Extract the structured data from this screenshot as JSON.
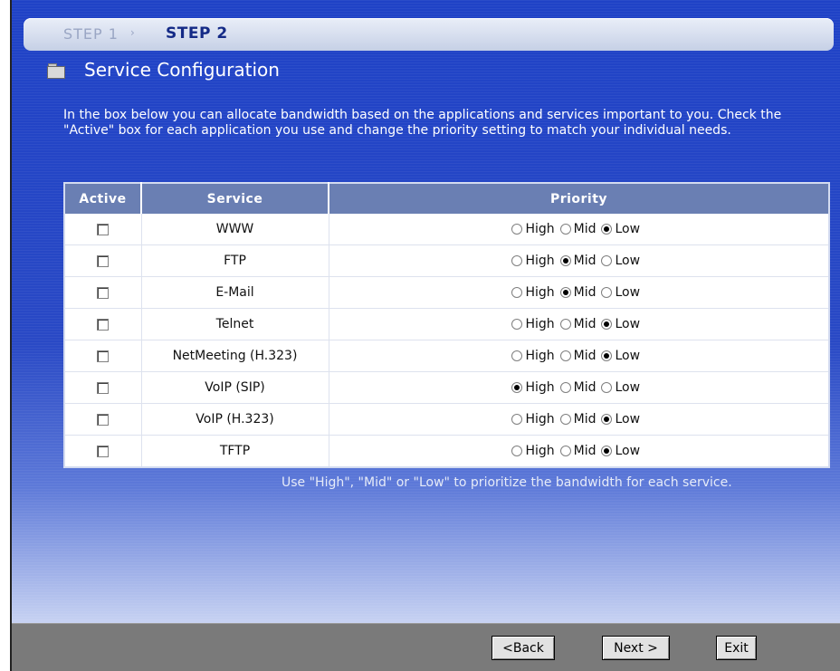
{
  "steps": {
    "step1": "STEP 1",
    "separator": "›",
    "step2": "STEP 2"
  },
  "page_title": "Service Configuration",
  "intro": "In the box below you can allocate bandwidth based on the applications and services important to you. Check the \"Active\" box for each application you use and change the priority setting to match your individual needs.",
  "table": {
    "headers": {
      "active": "Active",
      "service": "Service",
      "priority": "Priority"
    },
    "priority_options": [
      "High",
      "Mid",
      "Low"
    ],
    "rows": [
      {
        "active": false,
        "service": "WWW",
        "priority": "Low"
      },
      {
        "active": false,
        "service": "FTP",
        "priority": "Mid"
      },
      {
        "active": false,
        "service": "E-Mail",
        "priority": "Mid"
      },
      {
        "active": false,
        "service": "Telnet",
        "priority": "Low"
      },
      {
        "active": false,
        "service": "NetMeeting (H.323)",
        "priority": "Low"
      },
      {
        "active": false,
        "service": "VoIP (SIP)",
        "priority": "High"
      },
      {
        "active": false,
        "service": "VoIP (H.323)",
        "priority": "Low"
      },
      {
        "active": false,
        "service": "TFTP",
        "priority": "Low"
      }
    ]
  },
  "hint": "Use \"High\", \"Mid\" or \"Low\" to prioritize the bandwidth for each service.",
  "buttons": {
    "back": "<Back",
    "next": "Next >",
    "exit": "Exit"
  },
  "icons": {
    "title_icon": "folder-icon"
  }
}
